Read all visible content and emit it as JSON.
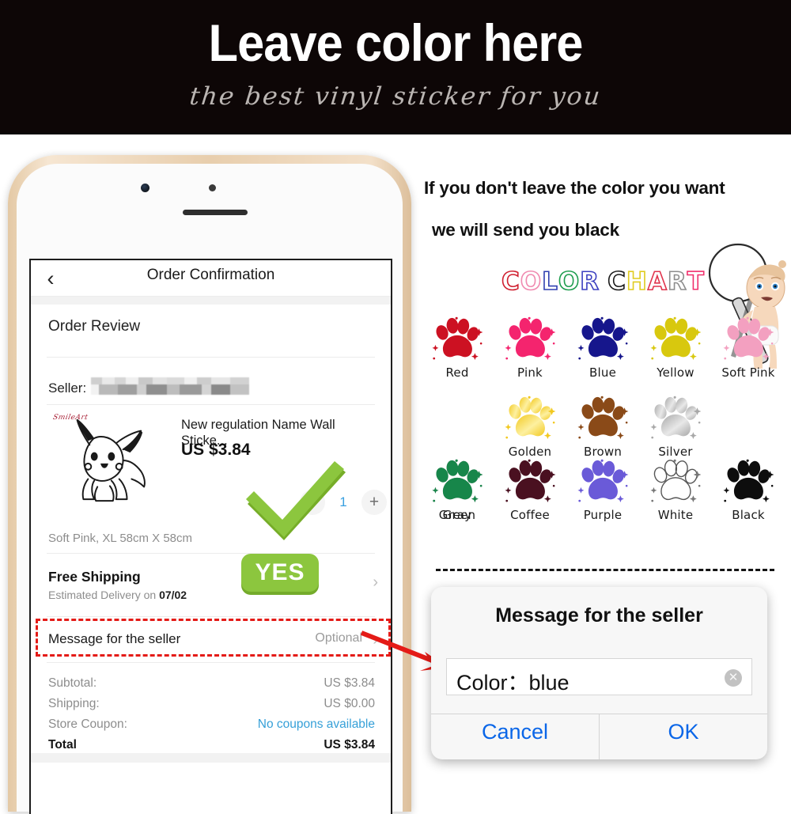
{
  "banner": {
    "title": "Leave color here",
    "subtitle": "the best vinyl sticker for you",
    "background": "#0d0606"
  },
  "phone_screen": {
    "nav": {
      "back_icon": "chevron-left-icon",
      "title": "Order Confirmation"
    },
    "section_title": "Order Review",
    "seller_label": "Seller:",
    "seller_value_blurred": true,
    "product": {
      "title": "New regulation Name Wall Sticke...",
      "price": "US $3.84",
      "variant": "Soft Pink, XL 58cm X 58cm",
      "thumb_watermark": "SmileArt",
      "thumb_alt": "pikachu-line-art"
    },
    "quantity": {
      "minus": "−",
      "value": "1",
      "plus": "+"
    },
    "shipping": {
      "title": "Free Shipping",
      "estimated_prefix": "Estimated Delivery on",
      "estimated_date": "07/02"
    },
    "message_row": {
      "label": "Message for the seller",
      "value": "Optional"
    },
    "totals": [
      {
        "label": "Subtotal:",
        "value": "US $3.84",
        "strong": false,
        "link": false
      },
      {
        "label": "Shipping:",
        "value": "US $0.00",
        "strong": false,
        "link": false
      },
      {
        "label": "Store Coupon:",
        "value": "No coupons available",
        "strong": false,
        "link": true
      },
      {
        "label": "Total",
        "value": "US $3.84",
        "strong": true,
        "link": false
      }
    ]
  },
  "annotations": {
    "yes_badge": "YES",
    "highlight_color": "#e41b17",
    "arrow_color": "#e41b17",
    "check_color": "#8cc63e"
  },
  "right_panel": {
    "note_line1": "If you don't leave the color you want",
    "note_line2": "we will send you black",
    "color_chart_title": "COLOR CHART",
    "color_chart_letters": [
      {
        "ch": "C",
        "color": "#d02030"
      },
      {
        "ch": "O",
        "color": "#f08ab0"
      },
      {
        "ch": "L",
        "color": "#2f3fb0"
      },
      {
        "ch": "O",
        "color": "#1f9e4f"
      },
      {
        "ch": "R",
        "color": "#3b3fc0"
      },
      {
        "ch": "C",
        "color": "#1a1a1a"
      },
      {
        "ch": "H",
        "color": "#e0cc20"
      },
      {
        "ch": "A",
        "color": "#e0344c"
      },
      {
        "ch": "R",
        "color": "#8d8d8d"
      },
      {
        "ch": "T",
        "color": "#f0306c"
      }
    ],
    "magnifier_icon": "magnifying-glass-icon",
    "baby_icon": "cartoon-baby-icon"
  },
  "color_chart": {
    "rows": [
      [
        {
          "name": "Red",
          "color": "#cc1122",
          "style": "solid"
        },
        {
          "name": "Pink",
          "color": "#f4246e",
          "style": "solid"
        },
        {
          "name": "Blue",
          "color": "#16168c",
          "style": "solid"
        },
        {
          "name": "Yellow",
          "color": "#d8c80e",
          "style": "solid"
        },
        {
          "name": "Soft Pink",
          "color": "#f3a0c0",
          "style": "solid"
        }
      ],
      [
        {
          "name": "Golden",
          "color": "#f2c81e",
          "style": "gradient",
          "color2": "#fdf0a0"
        },
        {
          "name": "Brown",
          "color": "#8a4a18",
          "style": "solid"
        },
        {
          "name": "Silver",
          "color": "#a8a8a8",
          "style": "gradient",
          "color2": "#e8e8e8"
        }
      ],
      [
        {
          "name": "Gray",
          "color": "#7c7c7c",
          "style": "solid"
        },
        {
          "name": "Coffee",
          "color": "#4a1020",
          "style": "solid"
        },
        {
          "name": "Purple",
          "color": "#6a5ad8",
          "style": "solid"
        },
        {
          "name": "White",
          "color": "#ffffff",
          "style": "outline"
        },
        {
          "name": "Black",
          "color": "#0d0d0d",
          "style": "solid"
        },
        {
          "name": "Green",
          "color": "#17864a",
          "style": "solid"
        }
      ]
    ]
  },
  "dialog": {
    "title": "Message for the seller",
    "input_value": "Color：blue",
    "clear_icon": "clear-circle-icon",
    "cancel_label": "Cancel",
    "ok_label": "OK",
    "button_color": "#0a66e8"
  }
}
